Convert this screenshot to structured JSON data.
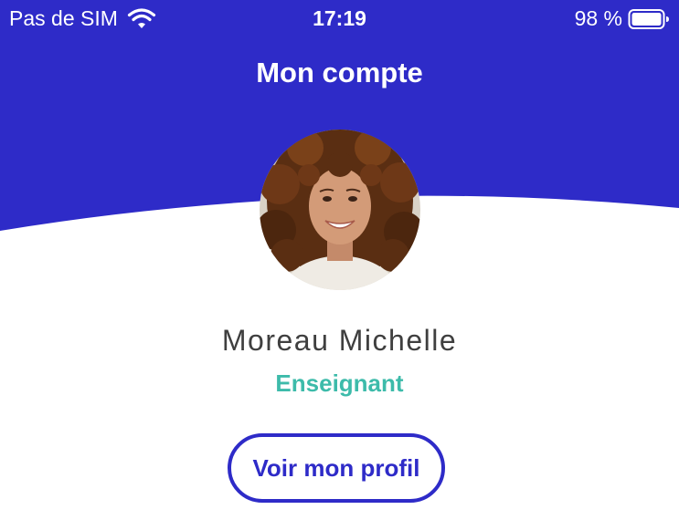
{
  "colors": {
    "primary": "#2e2bc8",
    "accent": "#3dbbaa",
    "name_text": "#3f3f3f",
    "background": "#ffffff"
  },
  "status_bar": {
    "carrier": "Pas de SIM",
    "time": "17:19",
    "battery": "98 %",
    "icons": [
      "wifi-icon",
      "battery-icon"
    ]
  },
  "header": {
    "title": "Mon compte"
  },
  "profile": {
    "name": "Moreau Michelle",
    "role": "Enseignant",
    "button_label": "Voir mon profil"
  }
}
